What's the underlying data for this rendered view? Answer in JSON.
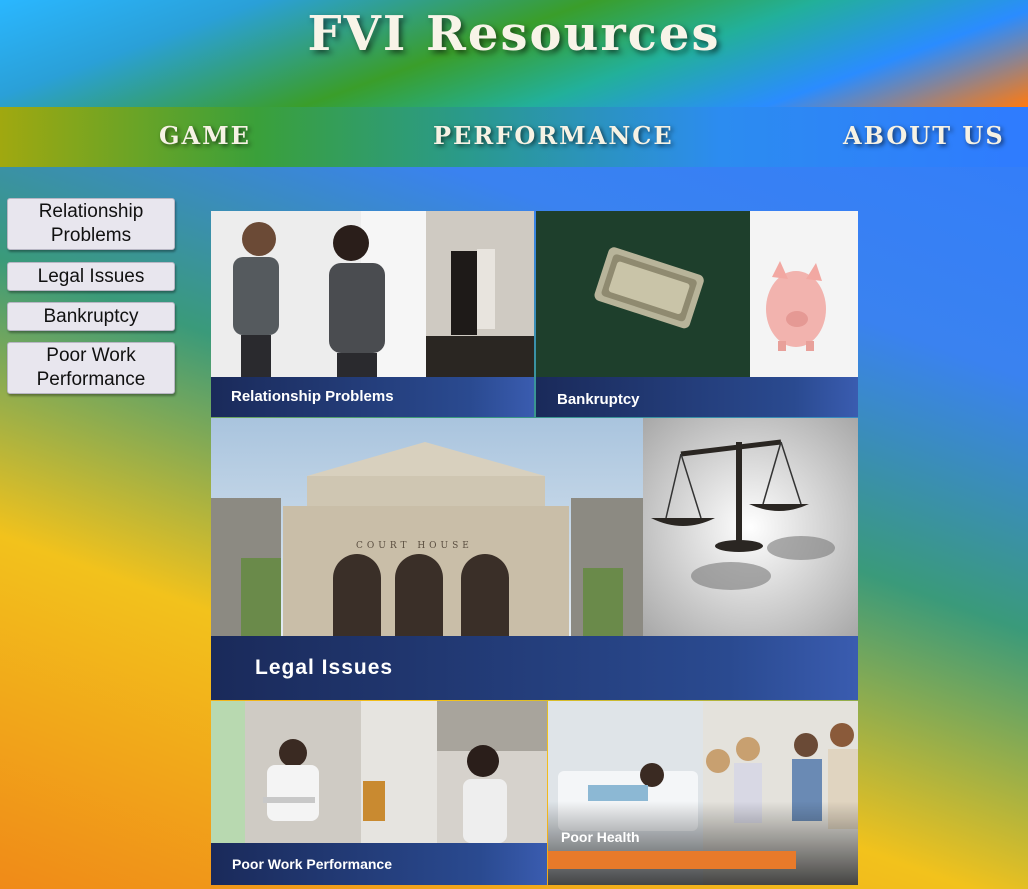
{
  "header": {
    "title": "FVI Resources"
  },
  "nav": {
    "items": [
      {
        "label": "GAME"
      },
      {
        "label": "PERFORMANCE"
      },
      {
        "label": "ABOUT US"
      }
    ]
  },
  "sidebar": {
    "items": [
      {
        "label": "Relationship Problems"
      },
      {
        "label": "Legal Issues"
      },
      {
        "label": "Bankruptcy"
      },
      {
        "label": "Poor Work Performance"
      }
    ]
  },
  "tiles": {
    "relationship": {
      "caption": "Relationship Problems"
    },
    "bankruptcy": {
      "caption": "Bankruptcy"
    },
    "legal": {
      "caption": "Legal Issues",
      "sign": "COURT HOUSE"
    },
    "work": {
      "caption": "Poor Work Performance"
    },
    "health": {
      "caption": "Poor Health"
    }
  },
  "colors": {
    "caption_bar": "#2a4a90",
    "health_bar": "#e87a2a",
    "button_bg": "#e8e6ee"
  }
}
